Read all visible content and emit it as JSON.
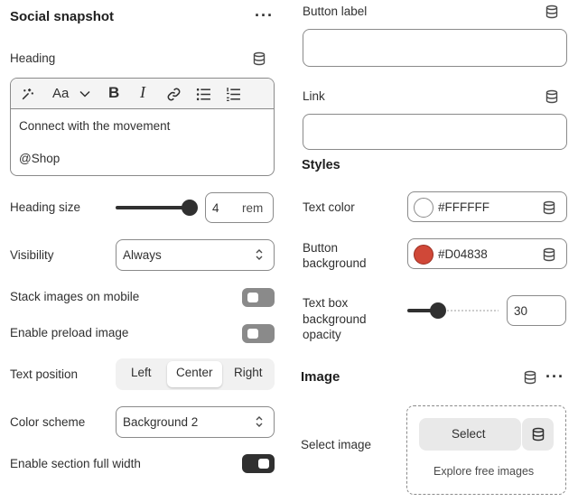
{
  "left": {
    "section_title": "Social snapshot",
    "heading": {
      "label": "Heading",
      "line1": "Connect with the movement",
      "line2": "@Shop",
      "toolbar": {
        "font_button": "Aa"
      }
    },
    "heading_size": {
      "label": "Heading size",
      "value": "4",
      "unit": "rem",
      "slider_fraction": 1.0
    },
    "visibility": {
      "label": "Visibility",
      "value": "Always"
    },
    "stack_images": {
      "label": "Stack images on mobile",
      "enabled": false
    },
    "preload_image": {
      "label": "Enable preload image",
      "enabled": false
    },
    "text_position": {
      "label": "Text position",
      "options": [
        "Left",
        "Center",
        "Right"
      ],
      "selected": "Center"
    },
    "color_scheme": {
      "label": "Color scheme",
      "value": "Background 2"
    },
    "full_width": {
      "label": "Enable section full width",
      "enabled": true
    }
  },
  "right": {
    "button_label": {
      "label": "Button label",
      "value": ""
    },
    "link": {
      "label": "Link",
      "value": ""
    },
    "styles_title": "Styles",
    "text_color": {
      "label": "Text color",
      "value": "#FFFFFF",
      "swatch": "#FFFFFF"
    },
    "button_background": {
      "label_line1": "Button",
      "label_line2": "background",
      "value": "#D04838",
      "swatch": "#D04838"
    },
    "text_box_opacity": {
      "label_line1": "Text box",
      "label_line2": "background",
      "label_line3": "opacity",
      "value": "30",
      "slider_fraction": 0.3
    },
    "image_title": "Image",
    "select_image": {
      "label": "Select image",
      "select_button": "Select",
      "explore_link": "Explore free images"
    }
  },
  "icons": [
    "database-icon",
    "more-icon",
    "magic-icon",
    "font-icon",
    "bold-icon",
    "italic-icon",
    "link-icon",
    "bullet-list-icon",
    "numbered-list-icon",
    "chevron-updown-icon"
  ]
}
